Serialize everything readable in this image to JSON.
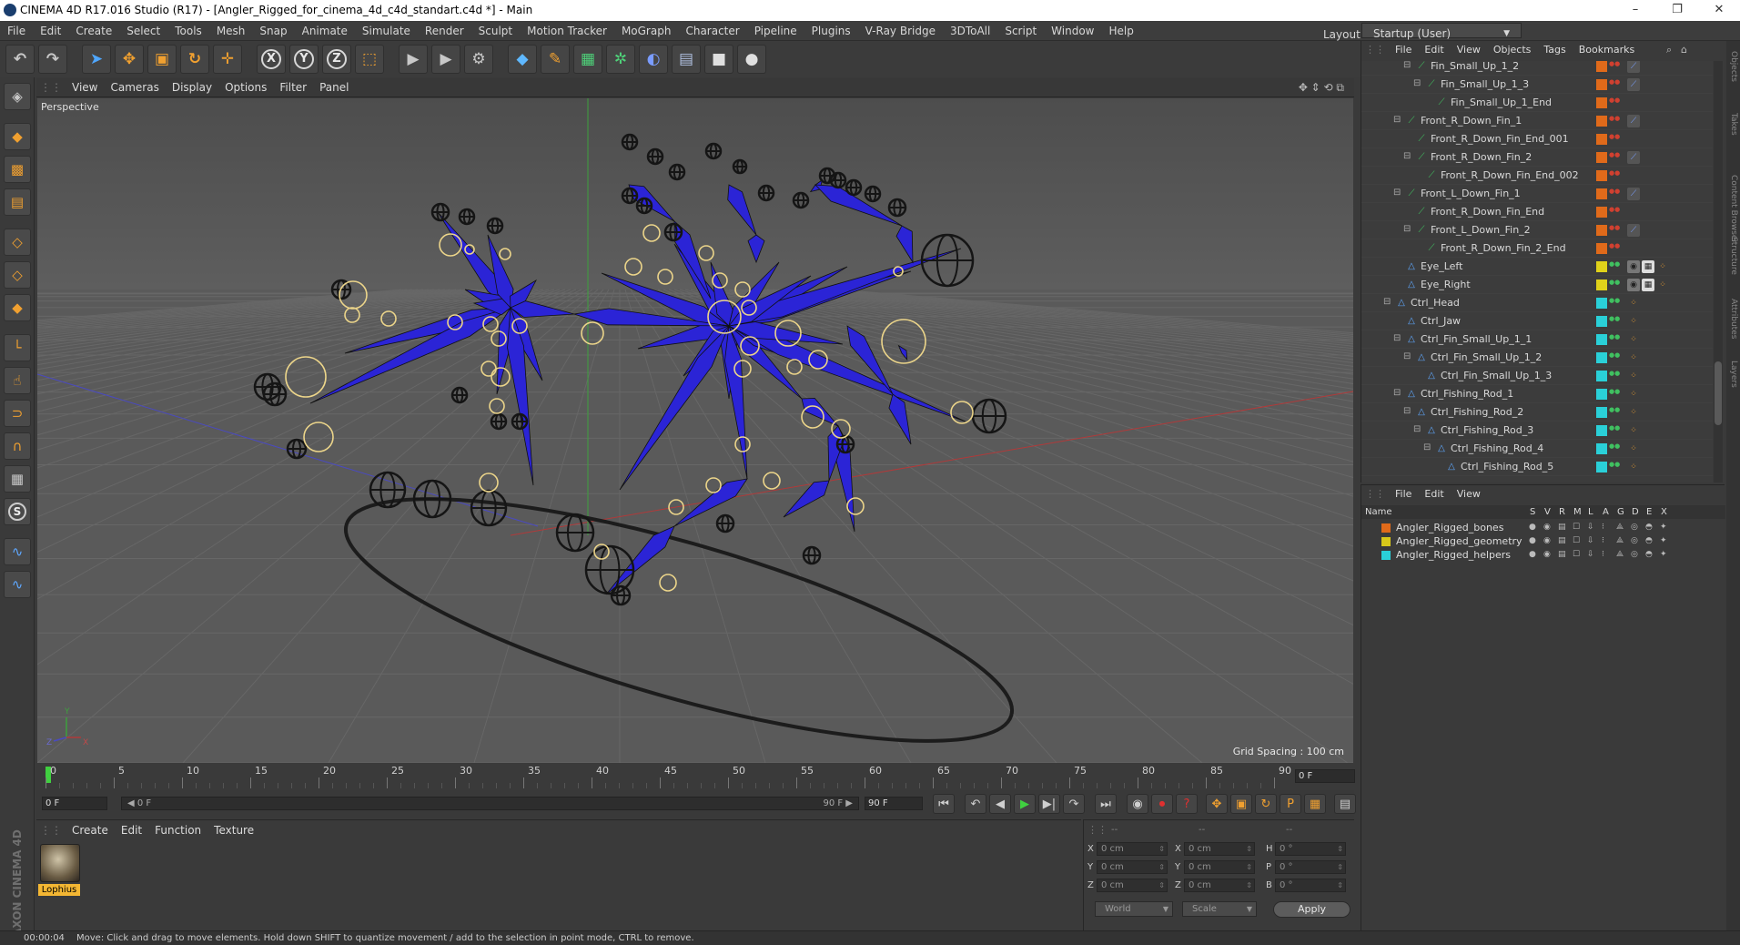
{
  "window": {
    "title": "CINEMA 4D R17.016 Studio (R17) - [Angler_Rigged_for_cinema_4d_c4d_standart.c4d *] - Main",
    "controls": [
      "–",
      "❐",
      "✕"
    ]
  },
  "menubar": {
    "items": [
      "File",
      "Edit",
      "Create",
      "Select",
      "Tools",
      "Mesh",
      "Snap",
      "Animate",
      "Simulate",
      "Render",
      "Sculpt",
      "Motion Tracker",
      "MoGraph",
      "Character",
      "Pipeline",
      "Plugins",
      "V-Ray Bridge",
      "3DToAll",
      "Script",
      "Window",
      "Help"
    ],
    "layout_label": "Layout:",
    "layout_value": "Startup (User)"
  },
  "toolbar": {
    "icons": [
      "undo-icon",
      "redo-icon",
      "live-selection-icon",
      "move-icon",
      "scale-icon",
      "rotate-icon",
      "recent-tool-icon",
      "x-axis-lock-icon",
      "y-axis-lock-icon",
      "z-axis-lock-icon",
      "world-coord-icon",
      "render-view-icon",
      "render-picture-viewer-icon",
      "render-settings-icon",
      "cube-icon",
      "pen-icon",
      "subdivision-icon",
      "cloner-icon",
      "deformer-icon",
      "floor-icon",
      "camera-icon",
      "light-icon"
    ],
    "axis_labels": [
      "X",
      "Y",
      "Z"
    ]
  },
  "left_tools": {
    "icons": [
      "make-editable-icon",
      "model-mode-icon",
      "texture-mode-icon",
      "workplane-icon",
      "points-mode-icon",
      "edges-mode-icon",
      "polygons-mode-icon",
      "axis-icon",
      "tweak-icon",
      "snap-icon",
      "magnet-icon",
      "grid-snap-icon",
      "solo-icon",
      "python-icon",
      "python-script-icon"
    ],
    "solo_glyph": "S"
  },
  "viewport": {
    "menu": [
      "View",
      "Cameras",
      "Display",
      "Options",
      "Filter",
      "Panel"
    ],
    "label": "Perspective",
    "grid_spacing": "Grid Spacing : 100 cm",
    "axis_letters": [
      "Y",
      "Z",
      "X"
    ]
  },
  "timeline": {
    "ticks": [
      "0",
      "5",
      "10",
      "15",
      "20",
      "25",
      "30",
      "35",
      "40",
      "45",
      "50",
      "55",
      "60",
      "65",
      "70",
      "75",
      "80",
      "85",
      "90"
    ],
    "current_frame": "0 F",
    "start_field": "0 F",
    "slider_left": "◀ 0 F",
    "slider_right": "90 F ▶",
    "end_field": "90 F"
  },
  "materials": {
    "menu": [
      "Create",
      "Edit",
      "Function",
      "Texture"
    ],
    "items": [
      {
        "name": "Lophius"
      }
    ],
    "brand_line1": "MAXON",
    "brand_line2": "CINEMA 4D"
  },
  "coordinates": {
    "headers": [
      "--",
      "--",
      "--"
    ],
    "rows": [
      {
        "a_label": "X",
        "a_value": "0 cm",
        "b_label": "X",
        "b_value": "0 cm",
        "c_label": "H",
        "c_value": "0 °"
      },
      {
        "a_label": "Y",
        "a_value": "0 cm",
        "b_label": "Y",
        "b_value": "0 cm",
        "c_label": "P",
        "c_value": "0 °"
      },
      {
        "a_label": "Z",
        "a_value": "0 cm",
        "b_label": "Z",
        "b_value": "0 cm",
        "c_label": "B",
        "c_value": "0 °"
      }
    ],
    "space": "World",
    "mode": "Scale",
    "apply": "Apply"
  },
  "status": {
    "time": "00:00:04",
    "message": "Move: Click and drag to move elements. Hold down SHIFT to quantize movement / add to the selection in point mode, CTRL to remove."
  },
  "object_manager": {
    "menu": [
      "File",
      "Edit",
      "View",
      "Objects",
      "Tags",
      "Bookmarks"
    ],
    "rows": [
      {
        "name": "Fin_Small_Up_1_2",
        "depth": 3,
        "kind": "bone",
        "color": "#e06a1a",
        "tags": "ik"
      },
      {
        "name": "Fin_Small_Up_1_3",
        "depth": 4,
        "kind": "bone",
        "color": "#e06a1a",
        "tags": "ik"
      },
      {
        "name": "Fin_Small_Up_1_End",
        "depth": 5,
        "kind": "bone",
        "color": "#e06a1a",
        "tags": ""
      },
      {
        "name": "Front_R_Down_Fin_1",
        "depth": 2,
        "kind": "bone",
        "color": "#e06a1a",
        "tags": "ik"
      },
      {
        "name": "Front_R_Down_Fin_End_001",
        "depth": 3,
        "kind": "bone",
        "color": "#e06a1a",
        "tags": ""
      },
      {
        "name": "Front_R_Down_Fin_2",
        "depth": 3,
        "kind": "bone",
        "color": "#e06a1a",
        "tags": "ik"
      },
      {
        "name": "Front_R_Down_Fin_End_002",
        "depth": 4,
        "kind": "bone",
        "color": "#e06a1a",
        "tags": ""
      },
      {
        "name": "Front_L_Down_Fin_1",
        "depth": 2,
        "kind": "bone",
        "color": "#e06a1a",
        "tags": "ik"
      },
      {
        "name": "Front_R_Down_Fin_End",
        "depth": 3,
        "kind": "bone",
        "color": "#e06a1a",
        "tags": ""
      },
      {
        "name": "Front_L_Down_Fin_2",
        "depth": 3,
        "kind": "bone",
        "color": "#e06a1a",
        "tags": "ik"
      },
      {
        "name": "Front_R_Down_Fin_2_End",
        "depth": 4,
        "kind": "bone",
        "color": "#e06a1a",
        "tags": ""
      },
      {
        "name": "Eye_Left",
        "depth": 2,
        "kind": "null",
        "color": "#e0d21a",
        "tags": "eye"
      },
      {
        "name": "Eye_Right",
        "depth": 2,
        "kind": "null",
        "color": "#e0d21a",
        "tags": "eye"
      },
      {
        "name": "Ctrl_Head",
        "depth": 1,
        "kind": "null",
        "color": "#2ad0d8",
        "tags": "dots"
      },
      {
        "name": "Ctrl_Jaw",
        "depth": 2,
        "kind": "null",
        "color": "#2ad0d8",
        "tags": "dots"
      },
      {
        "name": "Ctrl_Fin_Small_Up_1_1",
        "depth": 2,
        "kind": "null",
        "color": "#2ad0d8",
        "tags": "dots"
      },
      {
        "name": "Ctrl_Fin_Small_Up_1_2",
        "depth": 3,
        "kind": "null",
        "color": "#2ad0d8",
        "tags": "dots"
      },
      {
        "name": "Ctrl_Fin_Small_Up_1_3",
        "depth": 4,
        "kind": "null",
        "color": "#2ad0d8",
        "tags": "dots"
      },
      {
        "name": "Ctrl_Fishing_Rod_1",
        "depth": 2,
        "kind": "null",
        "color": "#2ad0d8",
        "tags": "dots"
      },
      {
        "name": "Ctrl_Fishing_Rod_2",
        "depth": 3,
        "kind": "null",
        "color": "#2ad0d8",
        "tags": "dots"
      },
      {
        "name": "Ctrl_Fishing_Rod_3",
        "depth": 4,
        "kind": "null",
        "color": "#2ad0d8",
        "tags": "dots"
      },
      {
        "name": "Ctrl_Fishing_Rod_4",
        "depth": 5,
        "kind": "null",
        "color": "#2ad0d8",
        "tags": "dots"
      },
      {
        "name": "Ctrl_Fishing_Rod_5",
        "depth": 6,
        "kind": "null",
        "color": "#2ad0d8",
        "tags": "dots"
      }
    ]
  },
  "side_tabs": [
    "Objects",
    "Takes",
    "Content Browser",
    "Structure",
    "Attributes",
    "Layers"
  ],
  "layer_manager": {
    "menu": [
      "File",
      "Edit",
      "View"
    ],
    "column_name": "Name",
    "columns": [
      "S",
      "V",
      "R",
      "M",
      "L",
      "A",
      "G",
      "D",
      "E",
      "X"
    ],
    "layers": [
      {
        "name": "Angler_Rigged_bones",
        "color": "#e06a1a"
      },
      {
        "name": "Angler_Rigged_geometry",
        "color": "#d8c81a"
      },
      {
        "name": "Angler_Rigged_helpers",
        "color": "#2ad0d8"
      }
    ]
  },
  "colors": {
    "bone_blue": "#2b24d6",
    "controller_yellow": "#ecd58a",
    "accent_orange": "#f4b733",
    "grid_line": "#676767"
  }
}
